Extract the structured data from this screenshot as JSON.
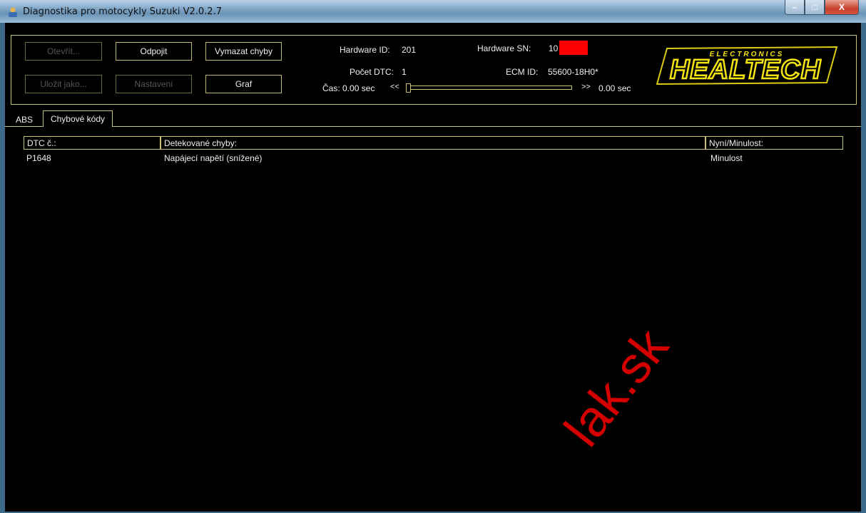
{
  "window": {
    "title": "Diagnostika pro motocykly Suzuki V2.0.2.7",
    "minimize": "–",
    "maximize": "□",
    "close": "X"
  },
  "toolbar": {
    "open_label": "Otevřít...",
    "disconnect_label": "Odpojit",
    "clear_errors_label": "Vymazat chyby",
    "save_as_label": "Uložit jako...",
    "settings_label": "Nastavení",
    "graph_label": "Graf"
  },
  "info": {
    "hw_id_label": "Hardware ID:",
    "hw_id_value": "201",
    "hw_sn_label": "Hardware SN:",
    "hw_sn_value": "10",
    "dtc_count_label": "Počet DTC:",
    "dtc_count_value": "1",
    "ecm_id_label": "ECM ID:",
    "ecm_id_value": "55600-18H0*",
    "time_label": "Čas: 0.00 sec",
    "rewind": "<<",
    "forward": ">>",
    "end_time": "0.00 sec"
  },
  "logo": {
    "main": "HEALTECH",
    "sub": "ELECTRONICS"
  },
  "tabs": [
    {
      "label": "ABS",
      "active": false
    },
    {
      "label": "Chybové kódy",
      "active": true
    }
  ],
  "table": {
    "columns": [
      "DTC č.:",
      "Detekované chyby:",
      "Nyní/Minulost:"
    ],
    "rows": [
      [
        "P1648",
        "Napájecí napětí (snížené)",
        "Minulost"
      ]
    ]
  },
  "watermark": "lak.sk",
  "colors": {
    "background": "#000000",
    "border": "#c9c27a",
    "text": "#eeeeee",
    "redact": "#ff0000",
    "logo_yellow": "#f4e313"
  }
}
